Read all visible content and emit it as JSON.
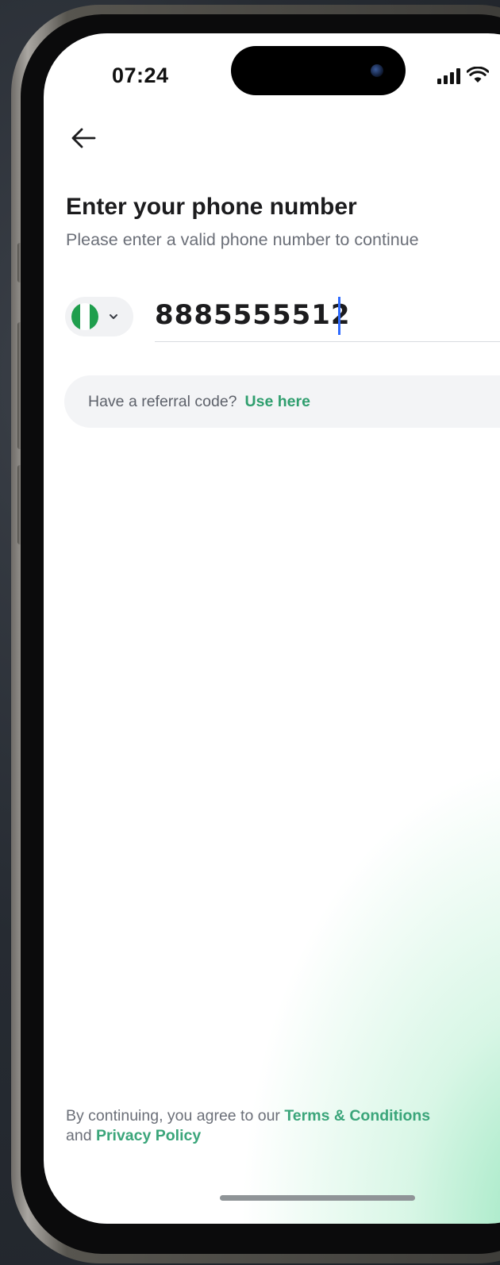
{
  "status_bar": {
    "time": "07:24",
    "signal_icon": "cellular-signal-icon",
    "wifi_icon": "wifi-icon"
  },
  "nav": {
    "back_icon": "arrow-left-icon"
  },
  "header": {
    "title": "Enter your phone number",
    "subtitle": "Please enter a valid phone number to continue"
  },
  "phone_form": {
    "country_flag_icon": "nigeria-flag-icon",
    "country_flag_colors": [
      "#1f9e4d",
      "#ffffff",
      "#1f9e4d"
    ],
    "dropdown_icon": "chevron-down-icon",
    "phone_value": "8885555512"
  },
  "referral": {
    "prompt": "Have a referral code?",
    "link_label": "Use here"
  },
  "legal": {
    "prefix": "By continuing, you agree to our ",
    "terms_label": "Terms & Conditions",
    "conjunction": " and ",
    "privacy_label": "Privacy Policy"
  },
  "colors": {
    "accent_green": "#2f9e6e",
    "caret_blue": "#2f6bff",
    "title_text": "#1c1c1e",
    "muted_text": "#6b6f78"
  }
}
